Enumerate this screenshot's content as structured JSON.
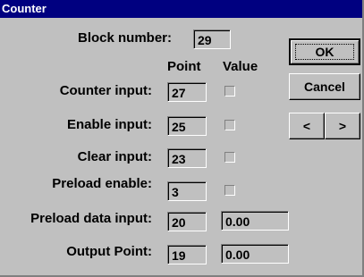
{
  "window": {
    "title": "Counter"
  },
  "block": {
    "label": "Block number:",
    "value": "29"
  },
  "columns": {
    "point": "Point",
    "value": "Value"
  },
  "rows": [
    {
      "label": "Counter input:",
      "point": "27"
    },
    {
      "label": "Enable input:",
      "point": "25"
    },
    {
      "label": "Clear input:",
      "point": "23"
    },
    {
      "label": "Preload enable:",
      "point": "3"
    },
    {
      "label": "Preload data input:",
      "point": "20",
      "value": "0.00"
    },
    {
      "label": "Output Point:",
      "point": "19",
      "value": "0.00"
    }
  ],
  "buttons": {
    "ok": "OK",
    "cancel": "Cancel",
    "prev": "<",
    "next": ">"
  }
}
